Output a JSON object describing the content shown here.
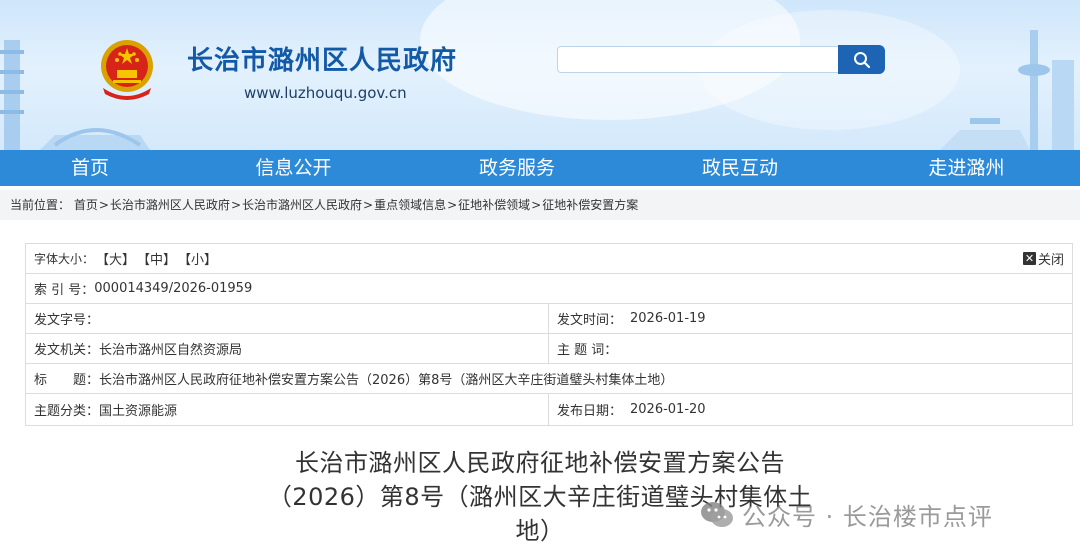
{
  "header": {
    "site_title": "长治市潞州区人民政府",
    "site_url": "www.luzhouqu.gov.cn",
    "search": {
      "placeholder": ""
    }
  },
  "nav": {
    "items": [
      "首页",
      "信息公开",
      "政务服务",
      "政民互动",
      "走进潞州"
    ]
  },
  "breadcrumb": {
    "prefix": "当前位置：",
    "items": [
      "首页",
      "长治市潞州区人民政府",
      "长治市潞州区人民政府",
      "重点领域信息",
      "征地补偿领域",
      "征地补偿安置方案"
    ],
    "separator": ">"
  },
  "info": {
    "font_size_label": "字体大小：",
    "font_large": "【大】",
    "font_medium": "【中】",
    "font_small": "【小】",
    "close_label": "关闭",
    "index_label": "索 引 号：",
    "index_value": "000014349/2026-01959",
    "doc_no_label": "发文字号：",
    "doc_no_value": "",
    "issue_time_label": "发文时间：",
    "issue_time_value": "2026-01-19",
    "issuer_label": "发文机关：",
    "issuer_value": "长治市潞州区自然资源局",
    "subject_words_label": "主 题 词：",
    "subject_words_value": "",
    "title_label": "标　　题：",
    "title_value": "长治市潞州区人民政府征地补偿安置方案公告（2026）第8号（潞州区大辛庄街道璧头村集体土地）",
    "category_label": "主题分类：",
    "category_value": "国土资源能源",
    "publish_date_label": "发布日期：",
    "publish_date_value": "2026-01-20"
  },
  "article": {
    "title_line1": "长治市潞州区人民政府征地补偿安置方案公告",
    "title_line2": "（2026）第8号（潞州区大辛庄街道璧头村集体土",
    "title_line3": "地）"
  },
  "watermark": {
    "text": "公众号 · 长治楼市点评"
  },
  "colors": {
    "nav_bg": "#2c8ad8",
    "title_blue": "#1259a7",
    "search_btn": "#1e64b4"
  }
}
